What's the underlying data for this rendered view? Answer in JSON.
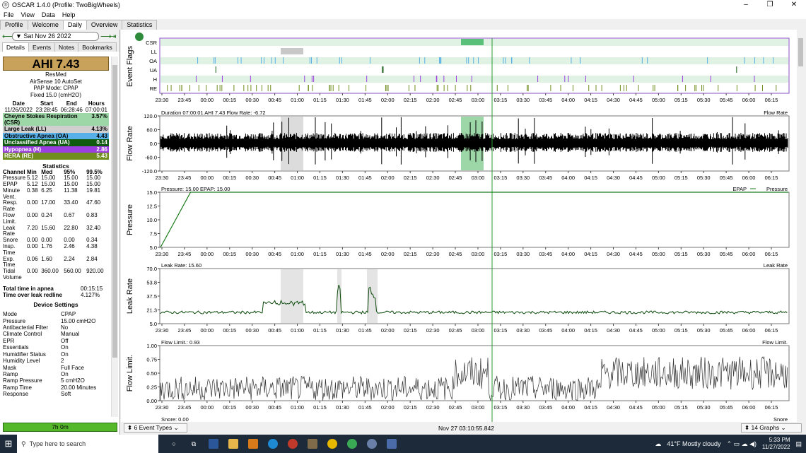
{
  "window": {
    "title": "OSCAR 1.4.0 (Profile: TwoBigWheels)",
    "controls": [
      "–",
      "❐",
      "✕"
    ]
  },
  "menu": [
    "File",
    "View",
    "Data",
    "Help"
  ],
  "tabs": [
    "Profile",
    "Welcome",
    "Daily",
    "Overview",
    "Statistics"
  ],
  "active_tab": "Daily",
  "date_nav": {
    "date": "Sat Nov 26 2022"
  },
  "subtabs": [
    "Details",
    "Events",
    "Notes",
    "Bookmarks"
  ],
  "summary": {
    "ahi": "AHI 7.43",
    "brand": "ResMed",
    "model": "AirSense 10 AutoSet",
    "mode": "PAP Mode: CPAP",
    "fixed": "Fixed 15.0 (cmH2O)"
  },
  "session": {
    "headers": [
      "Date",
      "Start",
      "End",
      "Hours"
    ],
    "values": [
      "11/26/2022",
      "23:28:45",
      "06:28:46",
      "07:00:01"
    ]
  },
  "indices": [
    {
      "label": "Cheyne Stokes Respiration (CSR)",
      "value": "3.57%",
      "color": "#9ed7a7"
    },
    {
      "label": "Large Leak (LL)",
      "value": "4.13%",
      "color": "#cfcfcf"
    },
    {
      "label": "Obstructive Apnea (OA)",
      "value": "4.43",
      "color": "#58b0e8"
    },
    {
      "label": "Unclassified Apnea (UA)",
      "value": "0.14",
      "color": "#0f5a0f"
    },
    {
      "label": "Hypopnea (H)",
      "value": "2.86",
      "color": "#9b3fe0"
    },
    {
      "label": "RERA (RE)",
      "value": "5.43",
      "color": "#6f8e1e"
    }
  ],
  "statistics": {
    "title": "Statistics",
    "headers": [
      "Channel",
      "Min",
      "Med",
      "95%",
      "99.5%"
    ],
    "rows": [
      [
        "Pressure",
        "5.12",
        "15.00",
        "15.00",
        "15.00"
      ],
      [
        "EPAP",
        "5.12",
        "15.00",
        "15.00",
        "15.00"
      ],
      [
        "Minute Vent.",
        "0.38",
        "6.25",
        "11.38",
        "19.81"
      ],
      [
        "Resp. Rate",
        "0.00",
        "17.00",
        "33.40",
        "47.60"
      ],
      [
        "Flow Limit.",
        "0.00",
        "0.24",
        "0.67",
        "0.83"
      ],
      [
        "Leak Rate",
        "7.20",
        "15.60",
        "22.80",
        "32.40"
      ],
      [
        "Snore",
        "0.00",
        "0.00",
        "0.00",
        "0.34"
      ],
      [
        "Insp. Time",
        "0.00",
        "1.76",
        "2.46",
        "4.38"
      ],
      [
        "Exp. Time",
        "0.06",
        "1.60",
        "2.24",
        "2.84"
      ],
      [
        "Tidal Volume",
        "0.00",
        "360.00",
        "560.00",
        "920.00"
      ]
    ]
  },
  "totals": [
    {
      "label": "Total time in apnea",
      "value": "00:15:15"
    },
    {
      "label": "Time over leak redline",
      "value": "4.127%"
    }
  ],
  "device_settings": {
    "title": "Device Settings",
    "rows": [
      [
        "Mode",
        "CPAP"
      ],
      [
        "Pressure",
        "15.00 cmH2O"
      ],
      [
        "Antibacterial Filter",
        "No"
      ],
      [
        "Climate Control",
        "Manual"
      ],
      [
        "EPR",
        "Off"
      ],
      [
        "Essentials",
        "On"
      ],
      [
        "Humidifier Status",
        "On"
      ],
      [
        "Humidity Level",
        "2"
      ],
      [
        "Mask",
        "Full Face"
      ],
      [
        "Ramp",
        "On"
      ],
      [
        "Ramp Pressure",
        "5 cmH2O"
      ],
      [
        "Ramp Time",
        "20.00 Minutes"
      ],
      [
        "Response",
        "Soft"
      ]
    ]
  },
  "usage": "7h 0m",
  "time_ticks": [
    "23:30",
    "23:45",
    "00:00",
    "00:15",
    "00:30",
    "00:45",
    "01:00",
    "01:15",
    "01:30",
    "01:45",
    "02:00",
    "02:15",
    "02:30",
    "02:45",
    "03:00",
    "03:15",
    "03:30",
    "03:45",
    "04:00",
    "04:15",
    "04:30",
    "04:45",
    "05:00",
    "05:15",
    "05:30",
    "05:45",
    "06:00",
    "06:15"
  ],
  "charts": {
    "event_flags": {
      "ylabel": "Event Flags",
      "rows": [
        "CSR",
        "LL",
        "OA",
        "UA",
        "H",
        "RE"
      ]
    },
    "flow_rate": {
      "ylabel": "Flow Rate",
      "title": "Duration 07:00:01 AHI 7.43 Flow Rate: -6.72",
      "legend": "Flow Rate",
      "yticks": [
        "120.0",
        "60.0",
        "0.0",
        "-60.0",
        "-120.0"
      ],
      "color": "#000000"
    },
    "pressure": {
      "ylabel": "Pressure",
      "title": "Pressure: 15.00 EPAP: 15.00",
      "legend_a": "EPAP",
      "legend_b": "Pressure",
      "yticks": [
        "15.0",
        "12.5",
        "10.0",
        "7.5",
        "5.0"
      ],
      "color": "#1a7a1a",
      "ramp_minutes": 20,
      "start_value": 5,
      "end_value": 15
    },
    "leak_rate": {
      "ylabel": "Leak Rate",
      "title": "Leak Rate: 15.60",
      "legend": "Leak Rate",
      "yticks": [
        "70.0",
        "53.8",
        "37.5",
        "21.3",
        "5.0"
      ],
      "color": "#0a4a0a"
    },
    "flow_limit": {
      "ylabel": "Flow Limit.",
      "title": "Flow Limit.: 0.93",
      "legend": "Flow Limit.",
      "yticks": [
        "1.00",
        "0.75",
        "0.50",
        "0.25",
        "0.00"
      ],
      "color": "#333333"
    },
    "snore": {
      "title": "Snore: 0.00",
      "legend": "Snore"
    }
  },
  "bottom": {
    "event_types": "6 Event Types",
    "timestamp": "Nov 27 03:10:55.842",
    "graphs": "14 Graphs"
  },
  "taskbar": {
    "search": "Type here to search",
    "weather": "41°F  Mostly cloudy",
    "time": "5:33 PM",
    "date": "11/27/2022"
  }
}
